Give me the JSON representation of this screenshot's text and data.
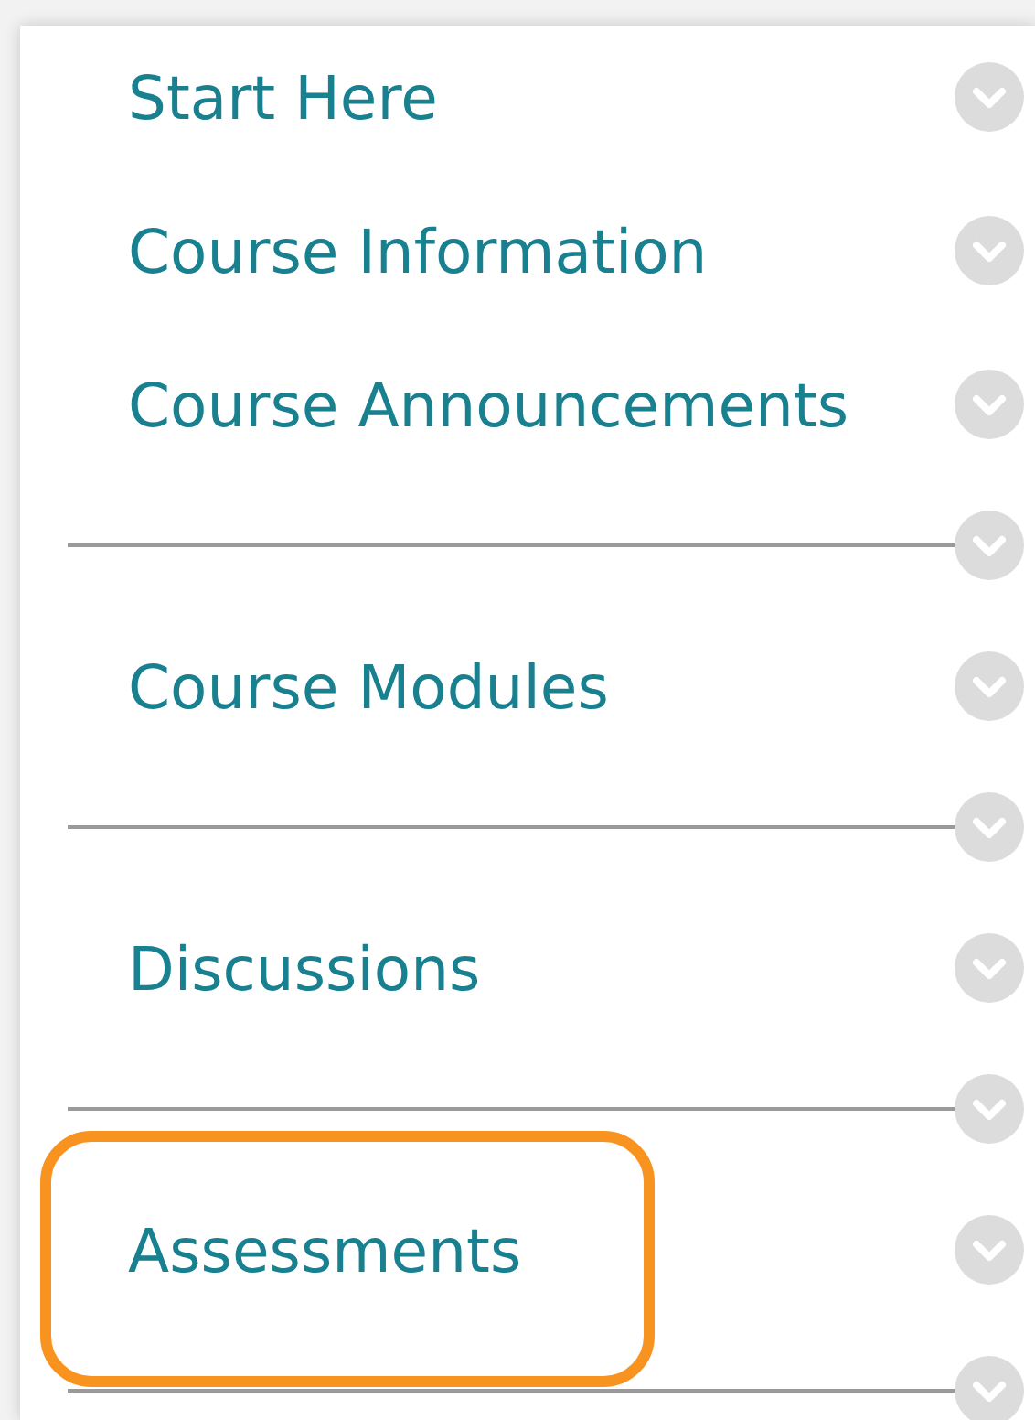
{
  "menu": {
    "items": [
      {
        "kind": "link",
        "label": "Start Here",
        "highlighted": false
      },
      {
        "kind": "link",
        "label": "Course Information",
        "highlighted": false
      },
      {
        "kind": "link",
        "label": "Course Announcements",
        "highlighted": false
      },
      {
        "kind": "divider"
      },
      {
        "kind": "link",
        "label": "Course Modules",
        "highlighted": false
      },
      {
        "kind": "divider"
      },
      {
        "kind": "link",
        "label": "Discussions",
        "highlighted": false
      },
      {
        "kind": "divider"
      },
      {
        "kind": "link",
        "label": "Assessments",
        "highlighted": true
      },
      {
        "kind": "divider"
      }
    ]
  }
}
